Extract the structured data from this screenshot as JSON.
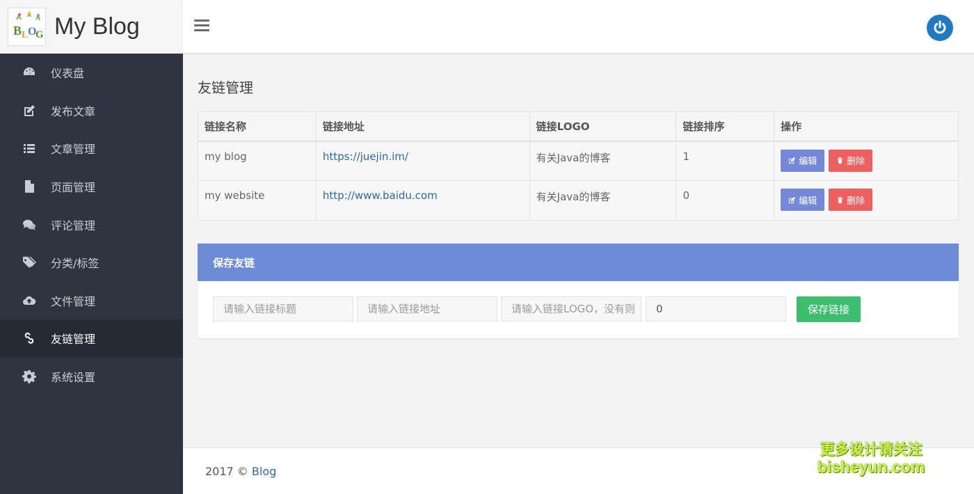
{
  "brand": {
    "title": "My Blog"
  },
  "sidebar": {
    "items": [
      {
        "label": "仪表盘",
        "icon": "dashboard-icon"
      },
      {
        "label": "发布文章",
        "icon": "edit-icon"
      },
      {
        "label": "文章管理",
        "icon": "list-icon"
      },
      {
        "label": "页面管理",
        "icon": "file-icon"
      },
      {
        "label": "评论管理",
        "icon": "comments-icon"
      },
      {
        "label": "分类/标签",
        "icon": "tags-icon"
      },
      {
        "label": "文件管理",
        "icon": "cloud-upload-icon"
      },
      {
        "label": "友链管理",
        "icon": "link-icon",
        "active": true
      },
      {
        "label": "系统设置",
        "icon": "gear-icon"
      }
    ]
  },
  "page": {
    "title": "友链管理"
  },
  "table": {
    "headers": [
      "链接名称",
      "链接地址",
      "链接LOGO",
      "链接排序",
      "操作"
    ],
    "rows": [
      {
        "name": "my blog",
        "url": "https://juejin.im/",
        "logo": "有关Java的博客",
        "sort": "1"
      },
      {
        "name": "my website",
        "url": "http://www.baidu.com",
        "logo": "有关Java的博客",
        "sort": "0"
      }
    ],
    "edit_label": "编辑",
    "delete_label": "删除"
  },
  "form": {
    "heading": "保存友链",
    "title_placeholder": "请输入链接标题",
    "url_placeholder": "请输入链接地址",
    "logo_placeholder": "请输入链接LOGO，没有则",
    "sort_value": "0",
    "submit_label": "保存链接"
  },
  "footer": {
    "text": "2017 © ",
    "link": "Blog"
  },
  "watermark": {
    "line1": "更多设计请关注",
    "line2": "bisheyun.com"
  },
  "colors": {
    "sidebar": "#2f3540",
    "accent": "#6e8bd8",
    "success": "#3dbd6e",
    "danger": "#ee5f5f",
    "power": "#1f7ac2"
  }
}
